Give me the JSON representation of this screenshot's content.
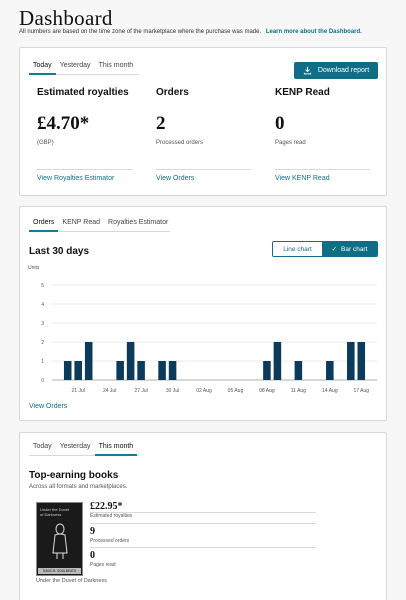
{
  "header": {
    "title": "Dashboard",
    "subtitle": "All numbers are based on the time zone of the marketplace where the purchase was made.",
    "learn_more": "Learn more about the Dashboard."
  },
  "summary": {
    "tabs": [
      {
        "label": "Today",
        "active": true
      },
      {
        "label": "Yesterday",
        "active": false
      },
      {
        "label": "This month",
        "active": false
      }
    ],
    "download_label": "Download report",
    "metrics": [
      {
        "title": "Estimated royalties",
        "value": "£4.70*",
        "caption": "(GBP)",
        "link": "View Royalties Estimator"
      },
      {
        "title": "Orders",
        "value": "2",
        "caption": "Processed orders",
        "link": "View Orders"
      },
      {
        "title": "KENP Read",
        "value": "0",
        "caption": "Pages read",
        "link": "View KENP Read"
      }
    ]
  },
  "chart_panel": {
    "tabs": [
      {
        "label": "Orders",
        "active": true
      },
      {
        "label": "KENP Read",
        "active": false
      },
      {
        "label": "Royalties Estimator",
        "active": false
      }
    ],
    "range_title": "Last 30 days",
    "line_chart_label": "Line chart",
    "bar_chart_label": "Bar chart",
    "active_chart": "bar",
    "view_link": "View Orders"
  },
  "chart_data": {
    "type": "bar",
    "ylabel": "Units",
    "ylim": [
      0,
      5
    ],
    "yticks": [
      0,
      1,
      2,
      3,
      4,
      5
    ],
    "categories": [
      "19 Jul",
      "20 Jul",
      "21 Jul",
      "22 Jul",
      "23 Jul",
      "24 Jul",
      "25 Jul",
      "26 Jul",
      "27 Jul",
      "28 Jul",
      "29 Jul",
      "30 Jul",
      "31 Jul",
      "01 Aug",
      "02 Aug",
      "03 Aug",
      "04 Aug",
      "05 Aug",
      "06 Aug",
      "07 Aug",
      "08 Aug",
      "09 Aug",
      "10 Aug",
      "11 Aug",
      "12 Aug",
      "13 Aug",
      "14 Aug",
      "15 Aug",
      "16 Aug",
      "17 Aug",
      "18 Aug"
    ],
    "values": [
      0,
      1,
      1,
      2,
      0,
      0,
      1,
      2,
      1,
      0,
      1,
      1,
      0,
      0,
      0,
      0,
      0,
      0,
      0,
      0,
      1,
      2,
      0,
      1,
      0,
      0,
      1,
      0,
      2,
      2,
      0
    ],
    "tick_labels": [
      {
        "category": "21 Jul",
        "label": "21 Jul"
      },
      {
        "category": "24 Jul",
        "label": "24 Jul"
      },
      {
        "category": "27 Jul",
        "label": "27 Jul"
      },
      {
        "category": "30 Jul",
        "label": "30 Jul"
      },
      {
        "category": "02 Aug",
        "label": "02 Aug"
      },
      {
        "category": "05 Aug",
        "label": "05 Aug"
      },
      {
        "category": "08 Aug",
        "label": "08 Aug"
      },
      {
        "category": "11 Aug",
        "label": "11 Aug"
      },
      {
        "category": "14 Aug",
        "label": "14 Aug"
      },
      {
        "category": "17 Aug",
        "label": "17 Aug"
      }
    ],
    "bar_color": "#0b3a5a",
    "grid": true
  },
  "top_books": {
    "tabs": [
      {
        "label": "Today",
        "active": false
      },
      {
        "label": "Yesterday",
        "active": false
      },
      {
        "label": "This month",
        "active": true
      }
    ],
    "title": "Top-earning books",
    "subtitle": "Across all formats and marketplaces.",
    "book": {
      "name": "Under the Duvet of Darkness",
      "cover_text": "Under the Duvet of Darkness",
      "cover_author": "DAVID B. SOULBEATS",
      "royalties": "£22.95*",
      "royalties_caption": "Estimated royalties",
      "orders": "9",
      "orders_caption": "Processed orders",
      "pages": "0",
      "pages_caption": "Pages read"
    }
  },
  "colors": {
    "accent": "#0f6e85",
    "link": "#0f6f8a",
    "bar": "#0b3a5a"
  }
}
